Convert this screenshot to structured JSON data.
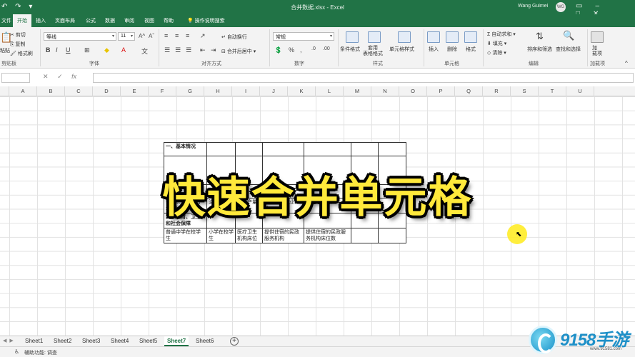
{
  "window": {
    "title": "合并数据.xlsx  -  Excel",
    "user": "Wang Guimei",
    "avatar": "WG"
  },
  "tabs": [
    "文件",
    "开始",
    "插入",
    "页面布局",
    "公式",
    "数据",
    "审阅",
    "视图",
    "帮助"
  ],
  "tell_me": "操作说明搜索",
  "ribbon": {
    "clipboard": {
      "cut": "剪切",
      "copy": "复制",
      "format_painter": "格式刷",
      "paste": "粘贴",
      "label": "剪贴板"
    },
    "font": {
      "name": "等线",
      "size": "11",
      "label": "字体"
    },
    "alignment": {
      "wrap": "自动换行",
      "merge": "合并后居中",
      "label": "对齐方式"
    },
    "number": {
      "format": "常规",
      "label": "数字"
    },
    "styles": {
      "conditional": "条件格式",
      "table": "套用\n表格格式",
      "cell": "单元格样式",
      "label": "样式"
    },
    "cells": {
      "insert": "插入",
      "delete": "删除",
      "format": "格式",
      "label": "单元格"
    },
    "editing": {
      "autosum": "自动求和",
      "fill": "填充",
      "clear": "清除",
      "sort": "排序和筛选",
      "find": "查找和选择",
      "label": "编辑"
    },
    "addins": {
      "btn": "加\n载项",
      "label": "加载项"
    }
  },
  "formula_bar": {
    "fx": "fx"
  },
  "columns": [
    "A",
    "B",
    "C",
    "D",
    "E",
    "F",
    "G",
    "H",
    "I",
    "J",
    "K",
    "L",
    "M",
    "N",
    "O",
    "P",
    "Q",
    "R",
    "S",
    "T",
    "U"
  ],
  "sheet_table": {
    "row1": "一、基本情况",
    "row2_partial": "和通信",
    "row3": [
      "设施农业种植占地面积",
      "油料产量",
      "棉花产量",
      "规模以上工业企业",
      "固定电话用户"
    ],
    "row4": "四、教育、卫生和社会保障",
    "row5": [
      "普通中学在校学生",
      "小学在校学生",
      "医疗卫生机构床位",
      "提供住宿的民政服务机构",
      "提供住宿的民政服务机构床位数"
    ]
  },
  "overlay_title": "快速合并单元格",
  "sheets": [
    "Sheet1",
    "Sheet2",
    "Sheet3",
    "Sheet4",
    "Sheet5",
    "Sheet7",
    "Sheet6"
  ],
  "active_sheet": "Sheet7",
  "status": "辅助功能: 调查",
  "watermark": {
    "brand": "9158手游",
    "url": "www.91581.com"
  }
}
